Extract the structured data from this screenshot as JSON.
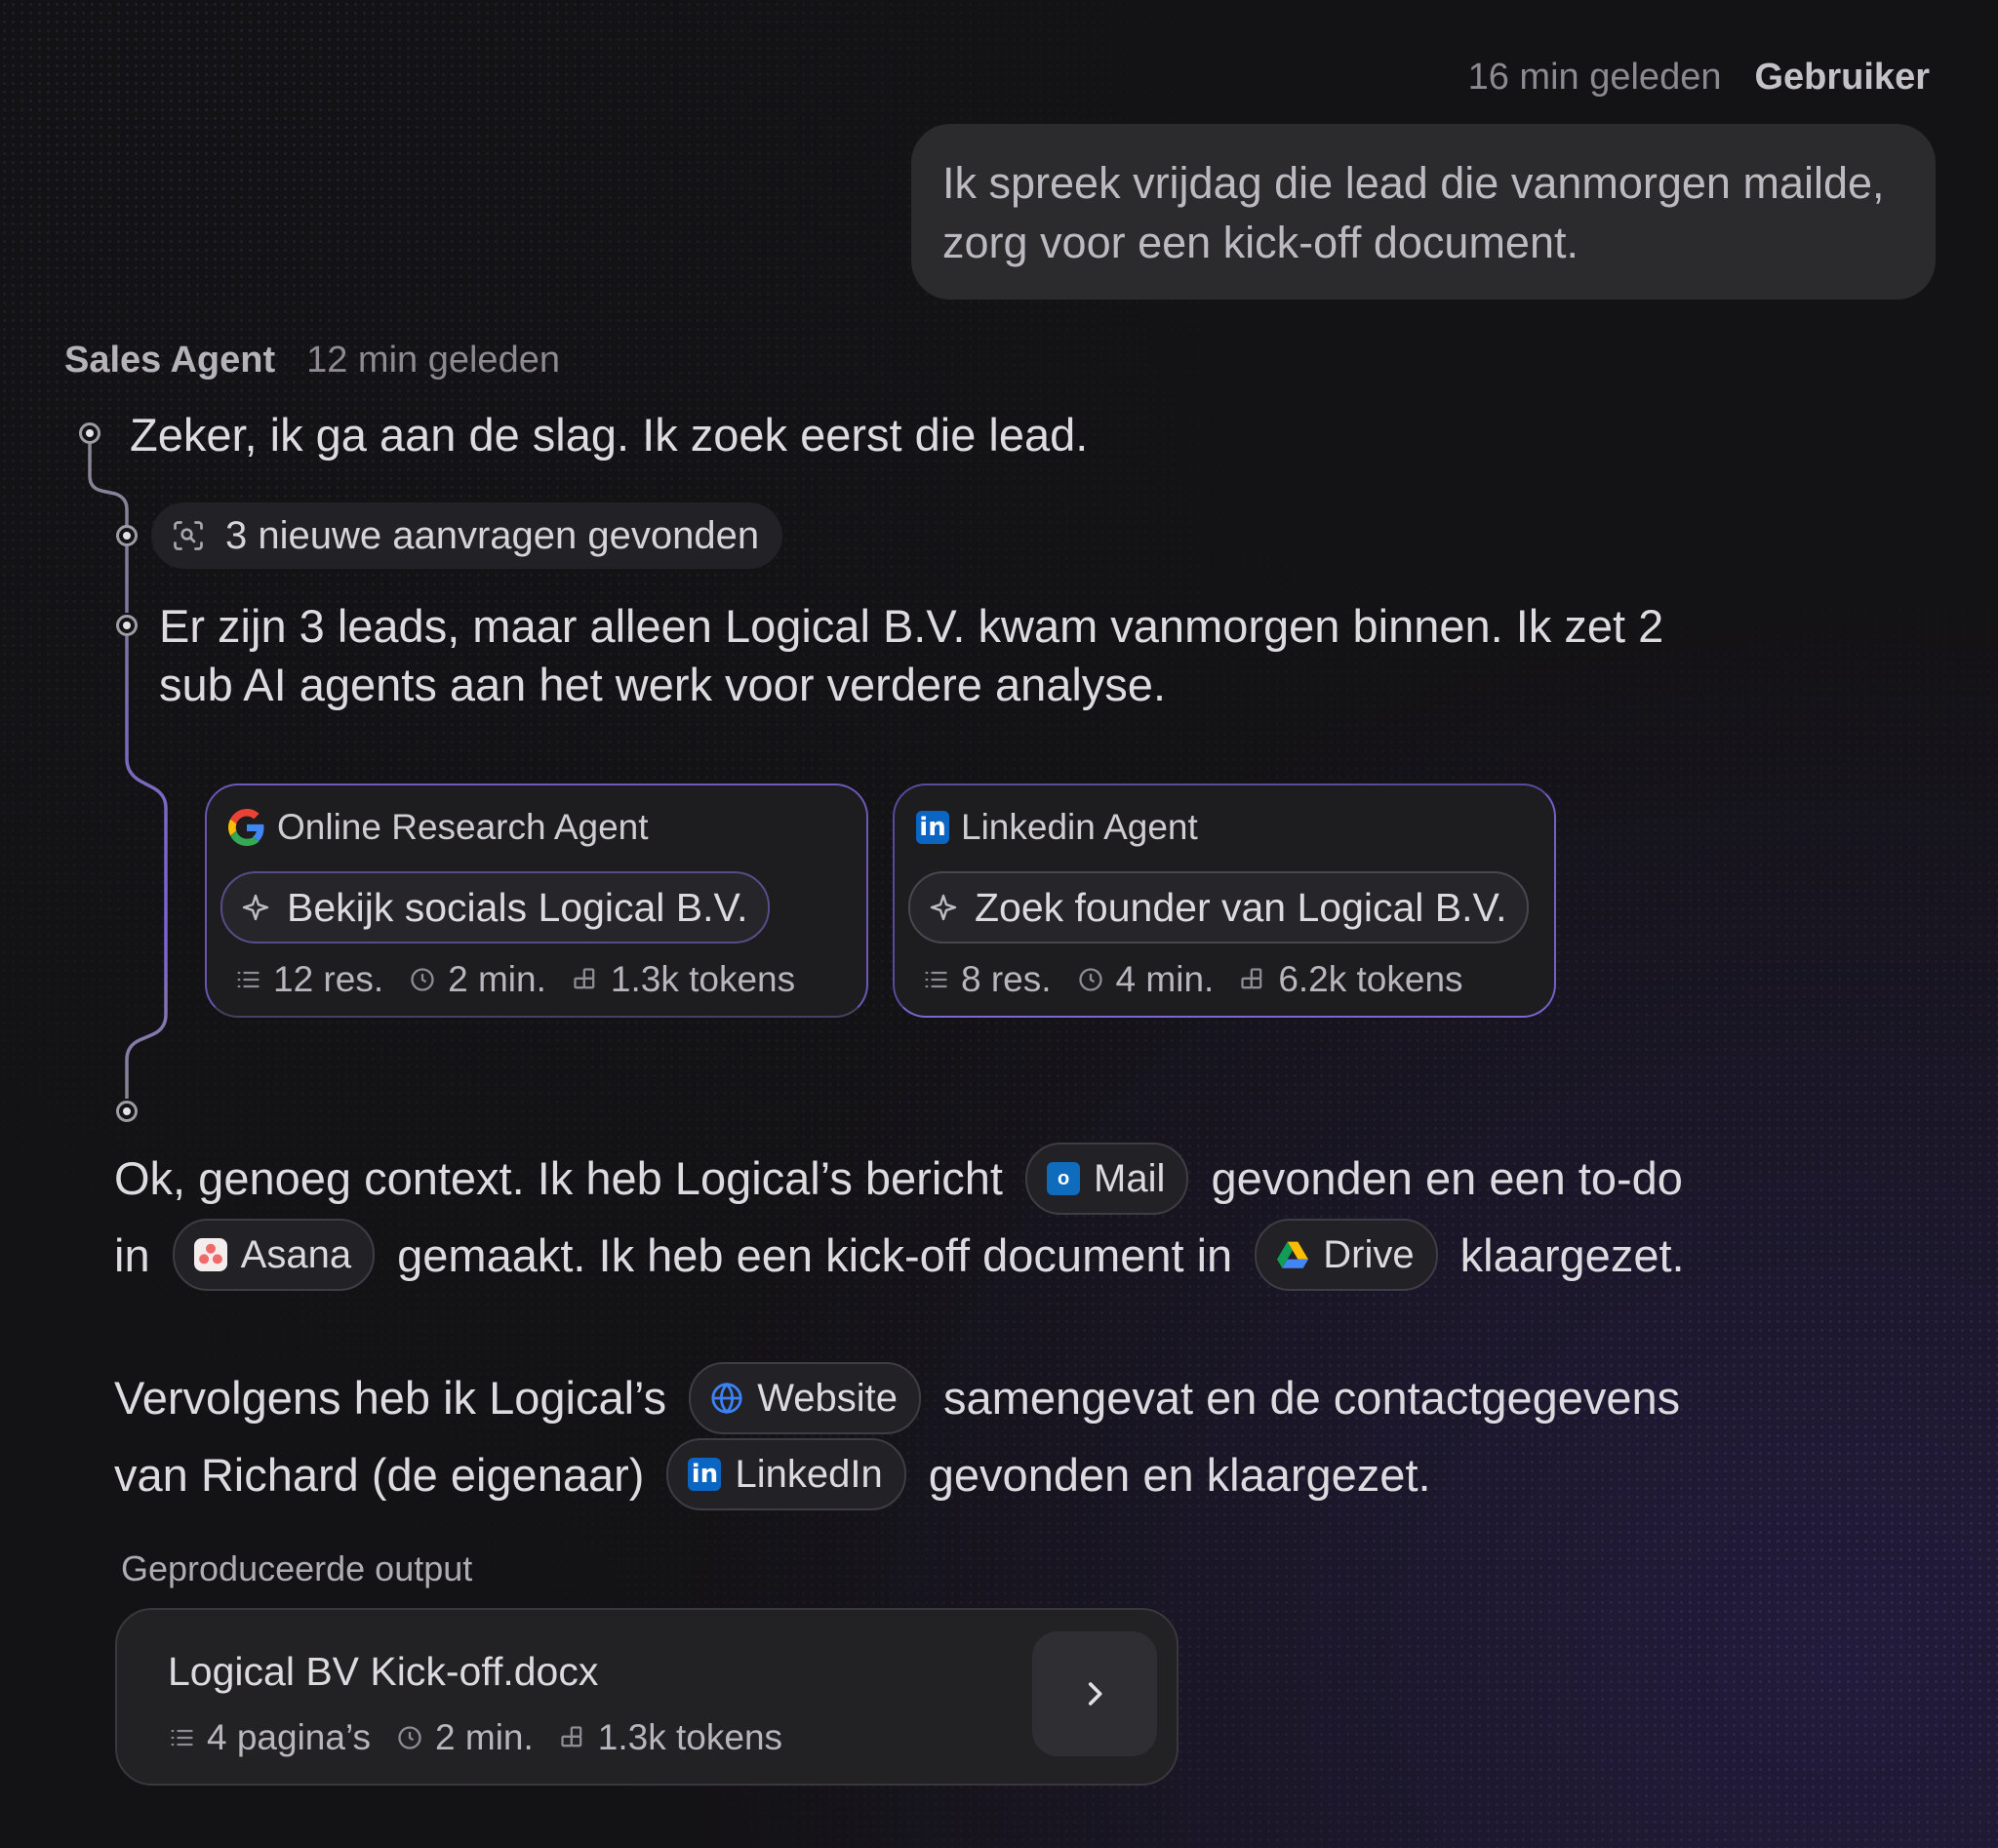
{
  "user": {
    "time": "16 min geleden",
    "name": "Gebruiker",
    "message": "Ik spreek vrijdag die lead die vanmorgen mailde, zorg voor een kick-off document."
  },
  "agent": {
    "name": "Sales Agent",
    "time": "12 min geleden",
    "step1": "Zeker, ik ga aan de slag. Ik zoek eerst die lead.",
    "tool_result": "3 nieuwe aanvragen gevonden",
    "step2": "Er zijn 3 leads, maar alleen Logical B.V. kwam vanmorgen binnen. Ik zet 2 sub AI agents aan het werk voor verdere analyse."
  },
  "sub_agents": [
    {
      "name": "Online Research Agent",
      "icon": "google-icon",
      "task": "Bekijk socials Logical B.V.",
      "results": "12 res.",
      "duration": "2 min.",
      "tokens": "1.3k tokens"
    },
    {
      "name": "Linkedin Agent",
      "icon": "linkedin-icon",
      "task": "Zoek founder van Logical B.V.",
      "results": "8 res.",
      "duration": "4 min.",
      "tokens": "6.2k tokens"
    }
  ],
  "summary": {
    "p1_a": "Ok, genoeg context. Ik heb Logical’s bericht",
    "chip_mail": "Mail",
    "p1_b": "gevonden en een to-do",
    "p1_c": "in",
    "chip_asana": "Asana",
    "p1_d": "gemaakt. Ik heb een kick-off document in",
    "chip_drive": "Drive",
    "p1_e": "klaargezet.",
    "p2_a": "Vervolgens heb ik Logical’s",
    "chip_website": "Website",
    "p2_b": "samengevat en de contactgegevens",
    "p2_c": "van Richard (de eigenaar)",
    "chip_linkedin": "LinkedIn",
    "p2_d": "gevonden en klaargezet."
  },
  "output": {
    "label": "Geproduceerde output",
    "file_name": "Logical BV Kick-off.docx",
    "pages": "4 pagina’s",
    "duration": "2 min.",
    "tokens": "1.3k tokens"
  },
  "colors": {
    "background": "#131214",
    "accent": "#7b63d6",
    "bubble": "#2b2a2d"
  }
}
